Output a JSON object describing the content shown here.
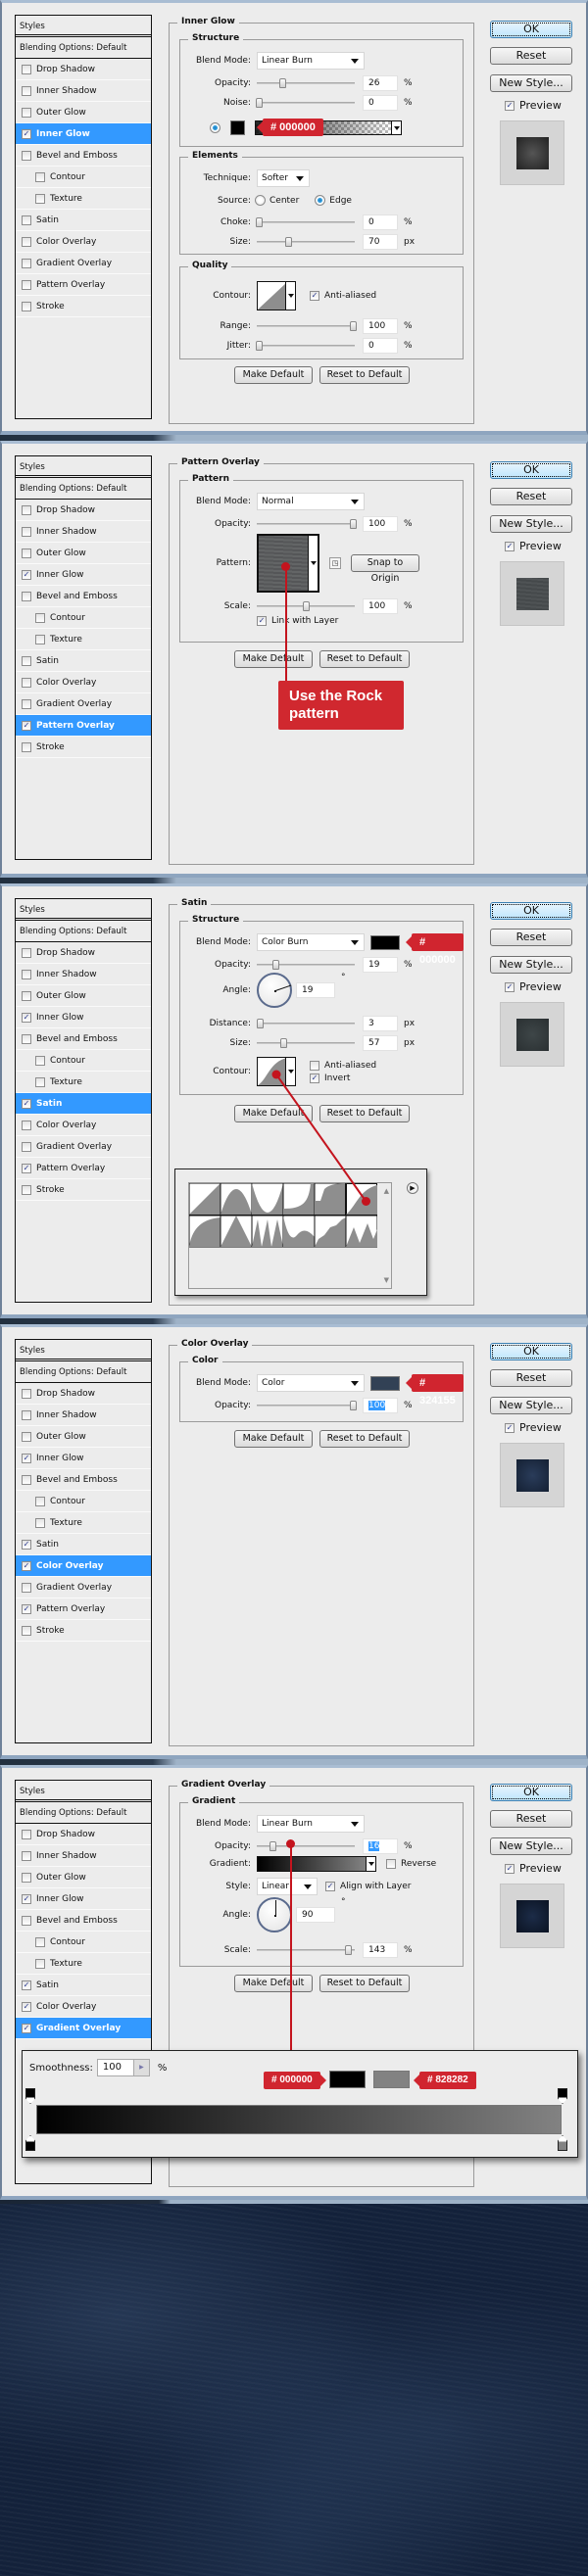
{
  "styles_header": "Styles",
  "blending_options": "Blending Options: Default",
  "side_buttons": {
    "ok": "OK",
    "reset": "Reset",
    "new_style": "New Style...",
    "preview": "Preview"
  },
  "common_buttons": {
    "make_default": "Make Default",
    "reset_to_default": "Reset to Default"
  },
  "dialogs": [
    {
      "active": "Inner Glow",
      "items": [
        {
          "label": "Drop Shadow",
          "checked": false
        },
        {
          "label": "Inner Shadow",
          "checked": false
        },
        {
          "label": "Outer Glow",
          "checked": false
        },
        {
          "label": "Inner Glow",
          "checked": true
        },
        {
          "label": "Bevel and Emboss",
          "checked": false
        },
        {
          "label": "Contour",
          "checked": false,
          "sub": true
        },
        {
          "label": "Texture",
          "checked": false,
          "sub": true
        },
        {
          "label": "Satin",
          "checked": false
        },
        {
          "label": "Color Overlay",
          "checked": false
        },
        {
          "label": "Gradient Overlay",
          "checked": false
        },
        {
          "label": "Pattern Overlay",
          "checked": false
        },
        {
          "label": "Stroke",
          "checked": false
        }
      ],
      "title": "Inner Glow",
      "structure": {
        "legend": "Structure",
        "blend_mode_label": "Blend Mode:",
        "blend_mode": "Linear Burn",
        "opacity_label": "Opacity:",
        "opacity": "26",
        "opacity_unit": "%",
        "noise_label": "Noise:",
        "noise": "0",
        "noise_unit": "%",
        "color_tag": "# 000000",
        "color": "#000000"
      },
      "elements": {
        "legend": "Elements",
        "technique_label": "Technique:",
        "technique": "Softer",
        "source_label": "Source:",
        "source_center": "Center",
        "source_edge": "Edge",
        "source_selected": "Edge",
        "choke_label": "Choke:",
        "choke": "0",
        "choke_unit": "%",
        "size_label": "Size:",
        "size": "70",
        "size_unit": "px"
      },
      "quality": {
        "legend": "Quality",
        "contour_label": "Contour:",
        "anti_aliased": "Anti-aliased",
        "anti_aliased_checked": true,
        "range_label": "Range:",
        "range": "100",
        "range_unit": "%",
        "jitter_label": "Jitter:",
        "jitter": "0",
        "jitter_unit": "%"
      }
    },
    {
      "active": "Pattern Overlay",
      "items": [
        {
          "label": "Drop Shadow",
          "checked": false
        },
        {
          "label": "Inner Shadow",
          "checked": false
        },
        {
          "label": "Outer Glow",
          "checked": false
        },
        {
          "label": "Inner Glow",
          "checked": true
        },
        {
          "label": "Bevel and Emboss",
          "checked": false
        },
        {
          "label": "Contour",
          "checked": false,
          "sub": true
        },
        {
          "label": "Texture",
          "checked": false,
          "sub": true
        },
        {
          "label": "Satin",
          "checked": false
        },
        {
          "label": "Color Overlay",
          "checked": false
        },
        {
          "label": "Gradient Overlay",
          "checked": false
        },
        {
          "label": "Pattern Overlay",
          "checked": true
        },
        {
          "label": "Stroke",
          "checked": false
        }
      ],
      "title": "Pattern Overlay",
      "pattern": {
        "legend": "Pattern",
        "blend_mode_label": "Blend Mode:",
        "blend_mode": "Normal",
        "opacity_label": "Opacity:",
        "opacity": "100",
        "opacity_unit": "%",
        "pattern_label": "Pattern:",
        "snap_to_origin": "Snap to Origin",
        "scale_label": "Scale:",
        "scale": "100",
        "scale_unit": "%",
        "link_with_layer": "Link with Layer",
        "link_checked": true
      },
      "callout": "Use the Rock pattern"
    },
    {
      "active": "Satin",
      "items": [
        {
          "label": "Drop Shadow",
          "checked": false
        },
        {
          "label": "Inner Shadow",
          "checked": false
        },
        {
          "label": "Outer Glow",
          "checked": false
        },
        {
          "label": "Inner Glow",
          "checked": true
        },
        {
          "label": "Bevel and Emboss",
          "checked": false
        },
        {
          "label": "Contour",
          "checked": false,
          "sub": true
        },
        {
          "label": "Texture",
          "checked": false,
          "sub": true
        },
        {
          "label": "Satin",
          "checked": true
        },
        {
          "label": "Color Overlay",
          "checked": false
        },
        {
          "label": "Gradient Overlay",
          "checked": false
        },
        {
          "label": "Pattern Overlay",
          "checked": true
        },
        {
          "label": "Stroke",
          "checked": false
        }
      ],
      "title": "Satin",
      "structure": {
        "legend": "Structure",
        "blend_mode_label": "Blend Mode:",
        "blend_mode": "Color Burn",
        "color_tag": "# 000000",
        "color": "#000000",
        "opacity_label": "Opacity:",
        "opacity": "19",
        "opacity_unit": "%",
        "angle_label": "Angle:",
        "angle": "19",
        "angle_unit": "°",
        "distance_label": "Distance:",
        "distance": "3",
        "distance_unit": "px",
        "size_label": "Size:",
        "size": "57",
        "size_unit": "px",
        "contour_label": "Contour:",
        "anti_aliased": "Anti-aliased",
        "anti_aliased_checked": false,
        "invert": "Invert",
        "invert_checked": true
      },
      "contour_picker": {
        "presets_count": 12,
        "selected_index": 5
      }
    },
    {
      "active": "Color Overlay",
      "items": [
        {
          "label": "Drop Shadow",
          "checked": false
        },
        {
          "label": "Inner Shadow",
          "checked": false
        },
        {
          "label": "Outer Glow",
          "checked": false
        },
        {
          "label": "Inner Glow",
          "checked": true
        },
        {
          "label": "Bevel and Emboss",
          "checked": false
        },
        {
          "label": "Contour",
          "checked": false,
          "sub": true
        },
        {
          "label": "Texture",
          "checked": false,
          "sub": true
        },
        {
          "label": "Satin",
          "checked": true
        },
        {
          "label": "Color Overlay",
          "checked": true
        },
        {
          "label": "Gradient Overlay",
          "checked": false
        },
        {
          "label": "Pattern Overlay",
          "checked": true
        },
        {
          "label": "Stroke",
          "checked": false
        }
      ],
      "title": "Color Overlay",
      "color": {
        "legend": "Color",
        "blend_mode_label": "Blend Mode:",
        "blend_mode": "Color",
        "color_tag": "# 324155",
        "color": "#324155",
        "opacity_label": "Opacity:",
        "opacity": "100",
        "opacity_unit": "%"
      }
    },
    {
      "active": "Gradient Overlay",
      "items": [
        {
          "label": "Drop Shadow",
          "checked": false
        },
        {
          "label": "Inner Shadow",
          "checked": false
        },
        {
          "label": "Outer Glow",
          "checked": false
        },
        {
          "label": "Inner Glow",
          "checked": true
        },
        {
          "label": "Bevel and Emboss",
          "checked": false
        },
        {
          "label": "Contour",
          "checked": false,
          "sub": true
        },
        {
          "label": "Texture",
          "checked": false,
          "sub": true
        },
        {
          "label": "Satin",
          "checked": true
        },
        {
          "label": "Color Overlay",
          "checked": true
        },
        {
          "label": "Gradient Overlay",
          "checked": true
        }
      ],
      "title": "Gradient Overlay",
      "gradient": {
        "legend": "Gradient",
        "blend_mode_label": "Blend Mode:",
        "blend_mode": "Linear Burn",
        "opacity_label": "Opacity:",
        "opacity": "16",
        "opacity_unit": "%",
        "gradient_label": "Gradient:",
        "reverse": "Reverse",
        "reverse_checked": false,
        "style_label": "Style:",
        "style": "Linear",
        "align_with_layer": "Align with Layer",
        "align_checked": true,
        "angle_label": "Angle:",
        "angle": "90",
        "angle_unit": "°",
        "scale_label": "Scale:",
        "scale": "143",
        "scale_unit": "%"
      },
      "gradient_editor": {
        "smoothness_label": "Smoothness:",
        "smoothness": "100",
        "smoothness_unit": "%",
        "stop_left_tag": "# 000000",
        "stop_left_color": "#000000",
        "stop_right_tag": "# 828282",
        "stop_right_color": "#828282"
      }
    }
  ],
  "colors": {
    "accent_red": "#d0252f",
    "selection_blue": "#3399ff",
    "dialog_bg": "#ececec"
  }
}
